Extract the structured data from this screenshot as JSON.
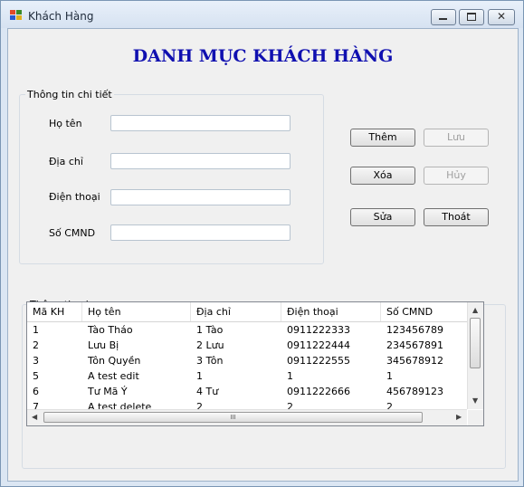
{
  "window": {
    "title": "Khách Hàng"
  },
  "heading": "DANH MỤC KHÁCH HÀNG",
  "detail": {
    "group_title": "Thông tin chi tiết",
    "fields": [
      {
        "label": "Họ tên",
        "value": ""
      },
      {
        "label": "Địa chỉ",
        "value": ""
      },
      {
        "label": "Điện thoại",
        "value": ""
      },
      {
        "label": "Số CMND",
        "value": ""
      }
    ]
  },
  "buttons": {
    "add": "Thêm",
    "save": "Lưu",
    "delete": "Xóa",
    "cancel": "Hủy",
    "edit": "Sửa",
    "exit": "Thoát"
  },
  "general": {
    "group_title": "Thông tin chung",
    "columns": [
      "Mã KH",
      "Họ tên",
      "Địa chỉ",
      "Điện thoại",
      "Số CMND"
    ],
    "rows": [
      [
        "1",
        "Tào Tháo",
        "1 Tào",
        "0911222333",
        "123456789"
      ],
      [
        "2",
        "Lưu Bị",
        "2 Lưu",
        "0911222444",
        "234567891"
      ],
      [
        "3",
        "Tôn Quyền",
        "3 Tôn",
        "0911222555",
        "345678912"
      ],
      [
        "5",
        "A test edit",
        "1",
        "1",
        "1"
      ],
      [
        "6",
        "Tư Mã Ý",
        "4 Tư",
        "0911222666",
        "456789123"
      ],
      [
        "7",
        "A test delete",
        "2",
        "2",
        "2"
      ]
    ],
    "scroll_glyph": "III"
  },
  "colors": {
    "heading": "#1010b0",
    "window_frame": "#dbe6f3"
  }
}
